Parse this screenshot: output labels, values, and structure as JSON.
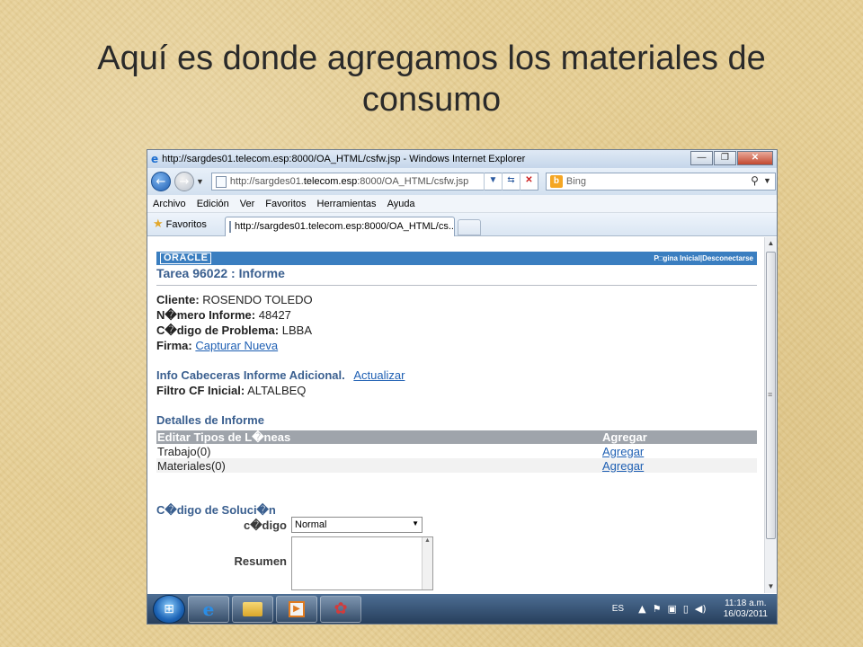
{
  "slide": {
    "title_line1": "Aquí es donde agregamos los materiales de",
    "title_line2": "consumo"
  },
  "browser": {
    "window_title": "http://sargdes01.telecom.esp:8000/OA_HTML/csfw.jsp - Windows Internet Explorer",
    "url_prefix": "http://sargdes01.",
    "url_host": "telecom.esp",
    "url_rest": ":8000/OA_HTML/csfw.jsp",
    "search_placeholder": "Bing",
    "menu": [
      "Archivo",
      "Edición",
      "Ver",
      "Favoritos",
      "Herramientas",
      "Ayuda"
    ],
    "favorites_label": "Favoritos",
    "tab_label": "http://sargdes01.telecom.esp:8000/OA_HTML/cs..."
  },
  "oracle": {
    "logo": "ORACLE",
    "top_links": "P□gina Inicial|Desconectarse",
    "task_title": "Tarea 96022 : Informe",
    "client_label": "Cliente:",
    "client_value": "ROSENDO TOLEDO",
    "report_label": "N�mero Informe:",
    "report_value": "48427",
    "problem_label": "C�digo de Problema:",
    "problem_value": "LBBA",
    "signature_label": "Firma:",
    "signature_link": "Capturar Nueva",
    "info_header": "Info Cabeceras Informe Adicional.",
    "info_link": "Actualizar",
    "filter_label": "Filtro CF Inicial:",
    "filter_value": "ALTALBEQ",
    "details_header": "Detalles de Informe",
    "table": {
      "headers": [
        "Editar Tipos de L�neas",
        "Agregar"
      ],
      "rows": [
        {
          "type": "Trabajo(0)",
          "action": "Agregar"
        },
        {
          "type": "Materiales(0)",
          "action": "Agregar"
        }
      ]
    },
    "solution_header": "C�digo de Soluci�n",
    "code_label": "c�digo",
    "code_selected": "Normal",
    "summary_label": "Resumen"
  },
  "taskbar": {
    "lang": "ES",
    "time": "11:18 a.m.",
    "date": "16/03/2011"
  }
}
